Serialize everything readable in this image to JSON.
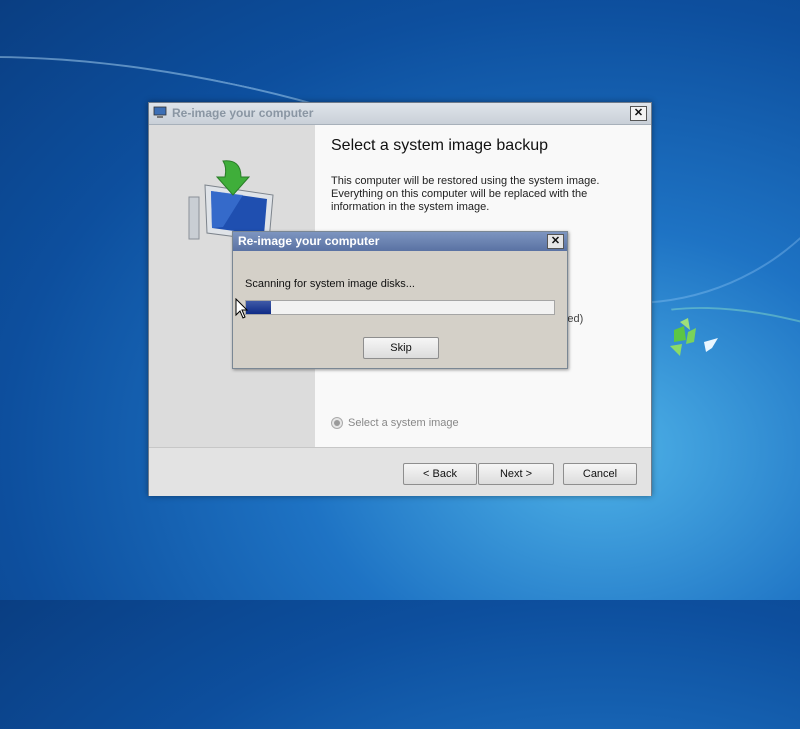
{
  "wizard": {
    "title": "Re-image your computer",
    "heading": "Select a system image backup",
    "description_lines": [
      "This computer will be restored using the system image.",
      "Everything on this computer will be replaced with the",
      "information in the system image."
    ],
    "partial_option_text": "ended)",
    "radio_select_image": "Select a system image",
    "buttons": {
      "back": "< Back",
      "next": "Next >",
      "cancel": "Cancel"
    },
    "close_glyph": "✕"
  },
  "dialog": {
    "title": "Re-image your computer",
    "message": "Scanning for system image disks...",
    "progress": 0.08,
    "skip": "Skip",
    "close_glyph": "✕"
  },
  "colors": {
    "progress_fill": "#1b3590",
    "desktop_blue": "#1e73c4"
  },
  "icons": {
    "wizard_titlebar": "computer-icon",
    "wizard_illustration": "computer-restore-icon",
    "desktop": "windows-logo-icon"
  }
}
